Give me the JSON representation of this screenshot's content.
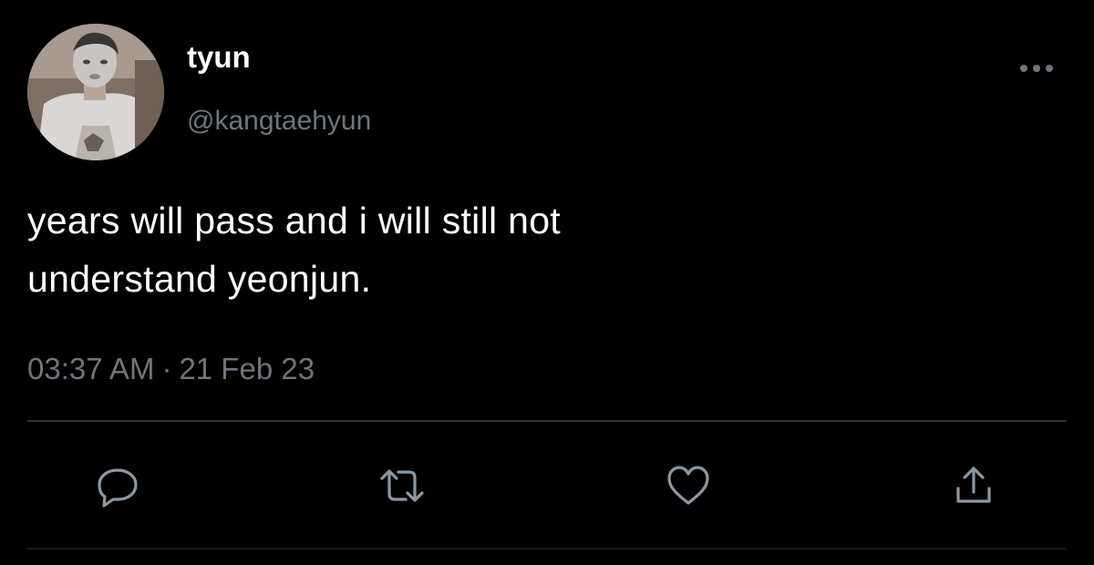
{
  "tweet": {
    "author": {
      "display_name": "tyun",
      "handle": "@kangtaehyun",
      "avatar": "avatar-photo"
    },
    "text_lines": [
      "years will pass and i will still not",
      "understand yeonjun."
    ],
    "time": "03:37 AM",
    "separator": "·",
    "date": "21 Feb 23",
    "actions": [
      "reply-icon",
      "retweet-icon",
      "like-icon",
      "share-icon"
    ],
    "more_icon": "more-icon"
  },
  "colors": {
    "background": "#000000",
    "primary_text": "#ffffff",
    "secondary_text": "#6e767d",
    "icon": "#8b98a5",
    "divider": "#2f3336"
  }
}
